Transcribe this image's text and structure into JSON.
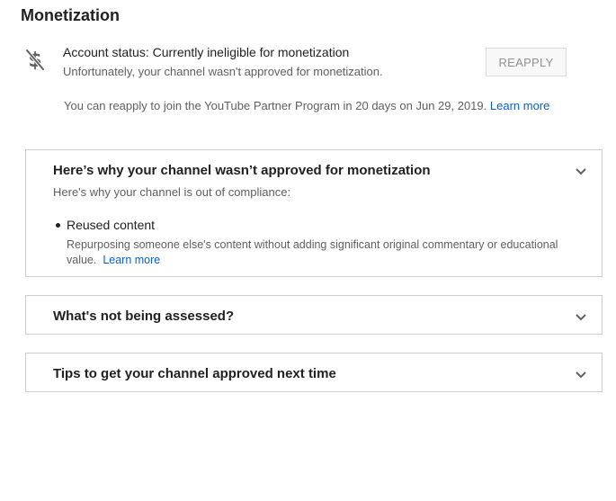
{
  "page": {
    "title": "Monetization"
  },
  "status": {
    "icon": "no-money-icon",
    "title": "Account status: Currently ineligible for monetization",
    "subtitle": "Unfortunately, your channel wasn't approved for monetization.",
    "reapply_label": "REAPPLY",
    "reapply_info": "You can reapply to join the YouTube Partner Program in 20 days on Jun 29, 2019.",
    "learn_more": "Learn more"
  },
  "panels": [
    {
      "header": "Here’s why your channel wasn’t approved for monetization",
      "description": "Here's why your channel is out of compliance:",
      "reasons": [
        {
          "title": "Reused content",
          "description": "Repurposing someone else's content without adding significant original commentary or educational value.",
          "learn_more": "Learn more"
        }
      ]
    },
    {
      "header": "What's not being assessed?"
    },
    {
      "header": "Tips to get your channel approved next time"
    }
  ],
  "colors": {
    "link": "#065fd4",
    "primary_text": "#212121",
    "secondary_text": "#606060",
    "border": "#cccccc"
  }
}
